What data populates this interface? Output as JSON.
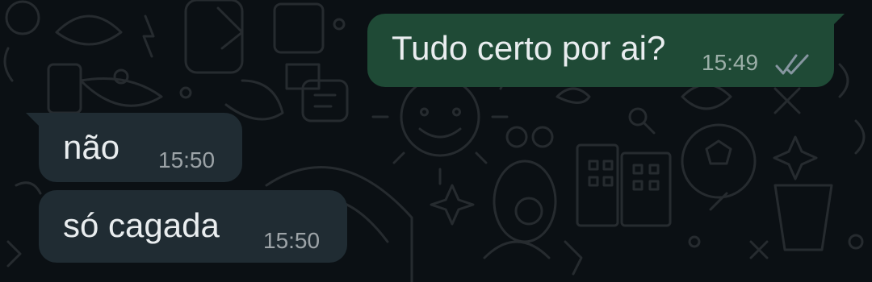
{
  "chat": {
    "messages": [
      {
        "direction": "outgoing",
        "text": "Tudo certo por ai?",
        "time": "15:49",
        "status": "read-check-icon"
      },
      {
        "direction": "incoming",
        "text": "não",
        "time": "15:50"
      },
      {
        "direction": "incoming",
        "text": "só cagada",
        "time": "15:50"
      }
    ]
  },
  "colors": {
    "background": "#0b1014",
    "outgoing_bubble": "#1f4a36",
    "incoming_bubble": "#202c33",
    "text": "#e9edef"
  }
}
